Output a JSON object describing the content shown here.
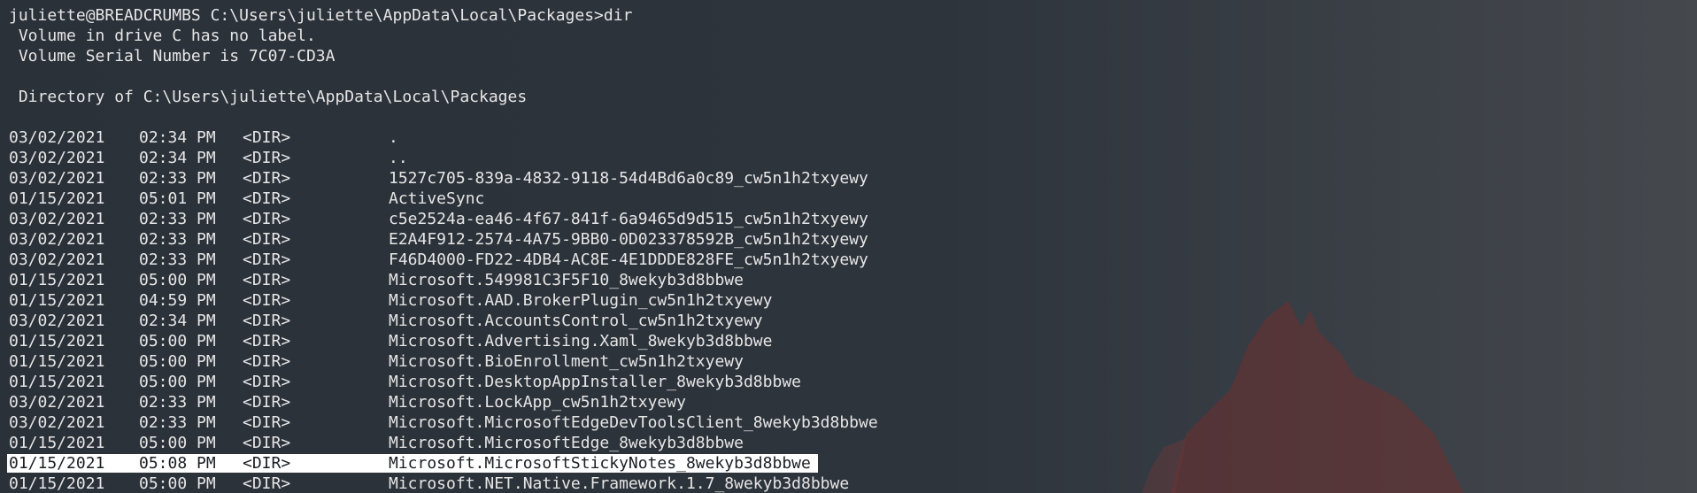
{
  "terminal": {
    "header_lines": [
      "juliette@BREADCRUMBS C:\\Users\\juliette\\AppData\\Local\\Packages>dir",
      " Volume in drive C has no label.",
      " Volume Serial Number is 7C07-CD3A",
      "",
      " Directory of C:\\Users\\juliette\\AppData\\Local\\Packages",
      ""
    ],
    "entries": [
      {
        "date": "03/02/2021",
        "time": "02:34 PM",
        "type": "<DIR>",
        "name": "."
      },
      {
        "date": "03/02/2021",
        "time": "02:34 PM",
        "type": "<DIR>",
        "name": ".."
      },
      {
        "date": "03/02/2021",
        "time": "02:33 PM",
        "type": "<DIR>",
        "name": "1527c705-839a-4832-9118-54d4Bd6a0c89_cw5n1h2txyewy"
      },
      {
        "date": "01/15/2021",
        "time": "05:01 PM",
        "type": "<DIR>",
        "name": "ActiveSync"
      },
      {
        "date": "03/02/2021",
        "time": "02:33 PM",
        "type": "<DIR>",
        "name": "c5e2524a-ea46-4f67-841f-6a9465d9d515_cw5n1h2txyewy"
      },
      {
        "date": "03/02/2021",
        "time": "02:33 PM",
        "type": "<DIR>",
        "name": "E2A4F912-2574-4A75-9BB0-0D023378592B_cw5n1h2txyewy"
      },
      {
        "date": "03/02/2021",
        "time": "02:33 PM",
        "type": "<DIR>",
        "name": "F46D4000-FD22-4DB4-AC8E-4E1DDDE828FE_cw5n1h2txyewy"
      },
      {
        "date": "01/15/2021",
        "time": "05:00 PM",
        "type": "<DIR>",
        "name": "Microsoft.549981C3F5F10_8wekyb3d8bbwe"
      },
      {
        "date": "01/15/2021",
        "time": "04:59 PM",
        "type": "<DIR>",
        "name": "Microsoft.AAD.BrokerPlugin_cw5n1h2txyewy"
      },
      {
        "date": "03/02/2021",
        "time": "02:34 PM",
        "type": "<DIR>",
        "name": "Microsoft.AccountsControl_cw5n1h2txyewy"
      },
      {
        "date": "01/15/2021",
        "time": "05:00 PM",
        "type": "<DIR>",
        "name": "Microsoft.Advertising.Xaml_8wekyb3d8bbwe"
      },
      {
        "date": "01/15/2021",
        "time": "05:00 PM",
        "type": "<DIR>",
        "name": "Microsoft.BioEnrollment_cw5n1h2txyewy"
      },
      {
        "date": "01/15/2021",
        "time": "05:00 PM",
        "type": "<DIR>",
        "name": "Microsoft.DesktopAppInstaller_8wekyb3d8bbwe"
      },
      {
        "date": "03/02/2021",
        "time": "02:33 PM",
        "type": "<DIR>",
        "name": "Microsoft.LockApp_cw5n1h2txyewy"
      },
      {
        "date": "03/02/2021",
        "time": "02:33 PM",
        "type": "<DIR>",
        "name": "Microsoft.MicrosoftEdgeDevToolsClient_8wekyb3d8bbwe"
      },
      {
        "date": "01/15/2021",
        "time": "05:00 PM",
        "type": "<DIR>",
        "name": "Microsoft.MicrosoftEdge_8wekyb3d8bbwe"
      },
      {
        "date": "01/15/2021",
        "time": "05:08 PM",
        "type": "<DIR>",
        "name": "Microsoft.MicrosoftStickyNotes_8wekyb3d8bbwe",
        "selected": true
      },
      {
        "date": "01/15/2021",
        "time": "05:00 PM",
        "type": "<DIR>",
        "name": "Microsoft.NET.Native.Framework.1.7_8wekyb3d8bbwe"
      }
    ]
  },
  "colors": {
    "background": "#2d333b",
    "text": "#e6e6e6",
    "selection": "#ffffff",
    "wallpaper_fox": "#6e2f2f"
  }
}
